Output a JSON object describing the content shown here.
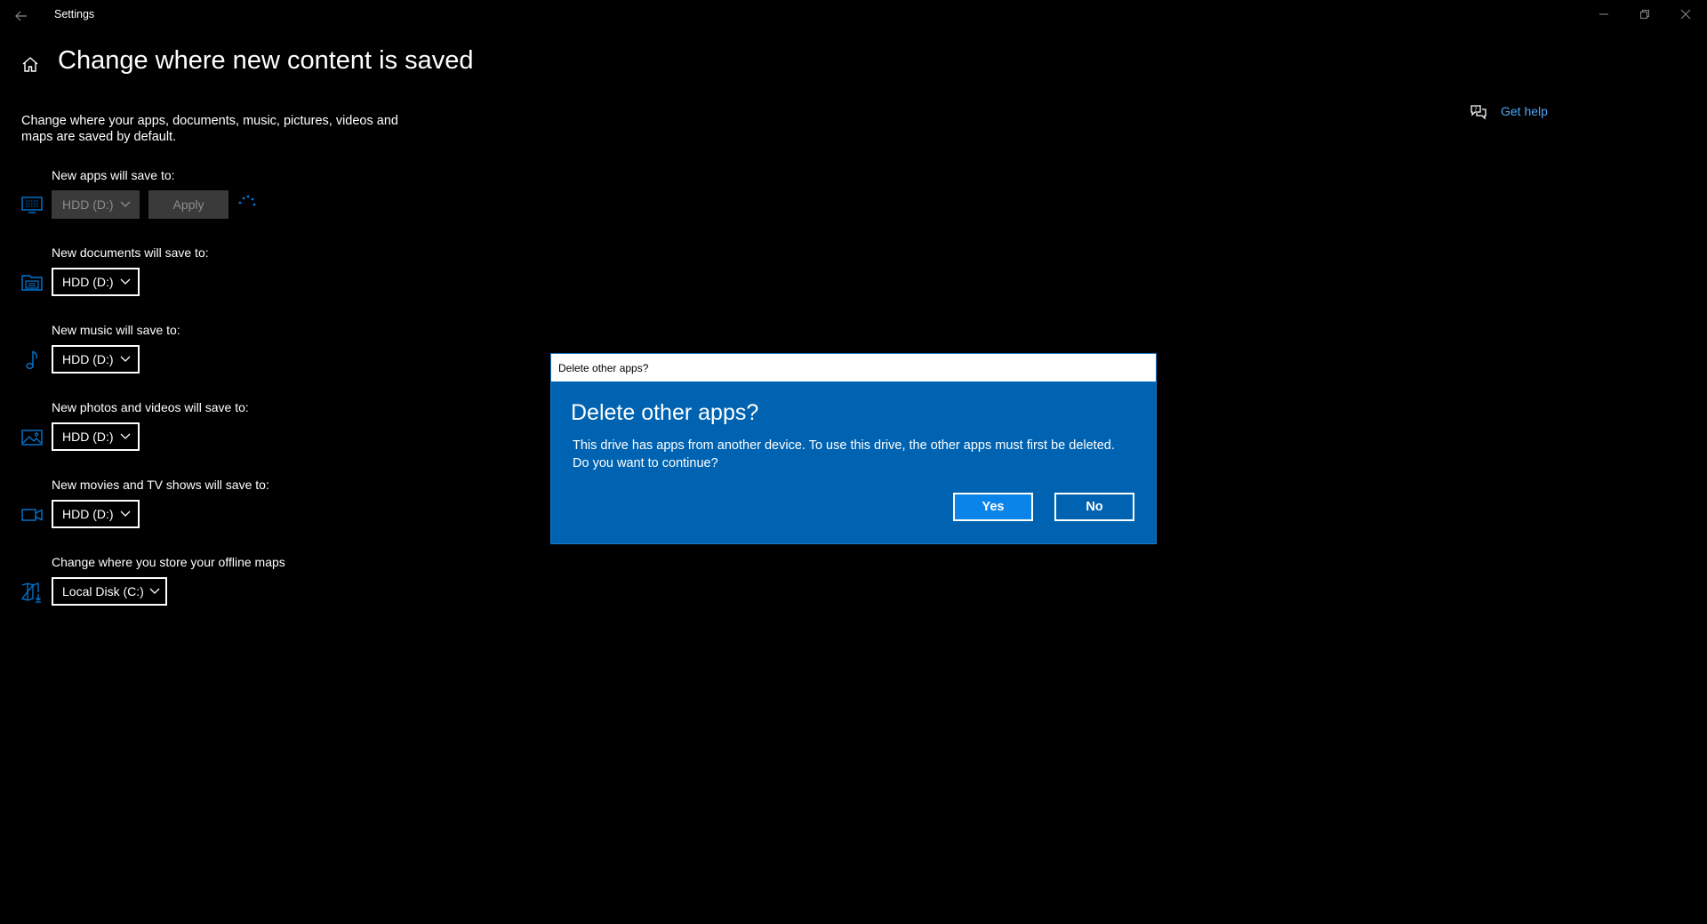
{
  "window": {
    "title": "Settings",
    "back_icon": "back-arrow-icon",
    "controls": [
      "minimize-icon",
      "restore-icon",
      "close-icon"
    ]
  },
  "header": {
    "home_icon": "home-icon",
    "title": "Change where new content is saved",
    "description": "Change where your apps, documents, music, pictures, videos and maps are saved by default."
  },
  "help": {
    "icon": "chat-help-icon",
    "label": "Get help"
  },
  "settings": [
    {
      "label": "New apps will save to:",
      "icon": "monitor-icon",
      "value": "HDD (D:)",
      "disabled": true
    },
    {
      "label": "New documents will save to:",
      "icon": "folder-documents-icon",
      "value": "HDD (D:)",
      "disabled": false
    },
    {
      "label": "New music will save to:",
      "icon": "music-note-icon",
      "value": "HDD (D:)",
      "disabled": false
    },
    {
      "label": "New photos and videos will save to:",
      "icon": "photo-icon",
      "value": "HDD (D:)",
      "disabled": false
    },
    {
      "label": "New movies and TV shows will save to:",
      "icon": "video-camera-icon",
      "value": "HDD (D:)",
      "disabled": false
    },
    {
      "label": "Change where you store your offline maps",
      "icon": "map-download-icon",
      "value": "Local Disk (C:)",
      "disabled": false
    }
  ],
  "apply_button": {
    "label": "Apply",
    "disabled": true
  },
  "dialog": {
    "window_title": "Delete other apps?",
    "heading": "Delete other apps?",
    "message": "This drive has apps from another device. To use this drive, the other apps must first be deleted. Do you want to continue?",
    "yes_label": "Yes",
    "no_label": "No"
  },
  "colors": {
    "accent": "#0078d7",
    "link": "#4ea6f5",
    "dialog_bg": "#0063b1",
    "disabled_bg": "#3a3a3a"
  }
}
